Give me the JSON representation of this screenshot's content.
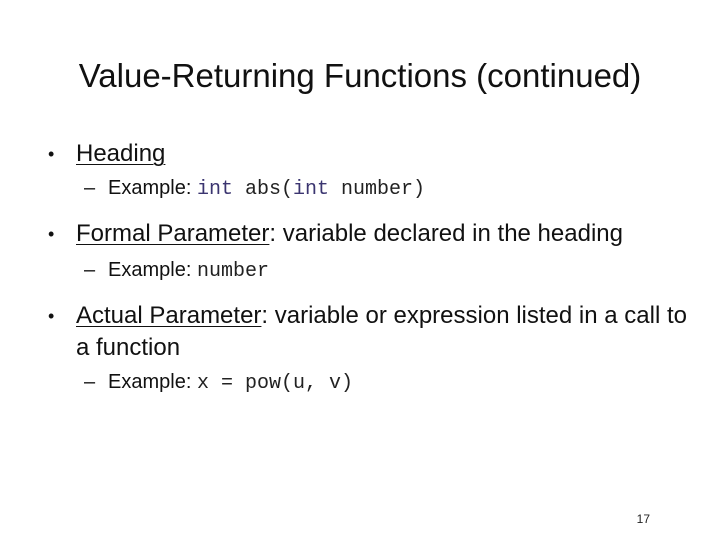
{
  "slide": {
    "title": "Value-Returning Functions (continued)",
    "page_number": "17",
    "bullet_glyph": "•",
    "dash_glyph": "–",
    "colors": {
      "text": "#111111",
      "keyword": "#3b3570",
      "background": "#ffffff"
    }
  },
  "items": [
    {
      "term": "Heading",
      "rest": "",
      "sub": {
        "label": "Example: ",
        "code": [
          {
            "text": "int",
            "kw": true
          },
          {
            "text": " abs(",
            "kw": false
          },
          {
            "text": "int",
            "kw": true
          },
          {
            "text": " number)",
            "kw": false
          }
        ]
      }
    },
    {
      "term": "Formal Parameter",
      "rest": ": variable declared in the heading",
      "sub": {
        "label": "Example: ",
        "code": [
          {
            "text": "number",
            "kw": false
          }
        ]
      }
    },
    {
      "term": "Actual Parameter",
      "rest": ": variable or expression listed in a call to a function",
      "sub": {
        "label": "Example: ",
        "code": [
          {
            "text": "x = pow(u, v)",
            "kw": false
          }
        ]
      }
    }
  ]
}
